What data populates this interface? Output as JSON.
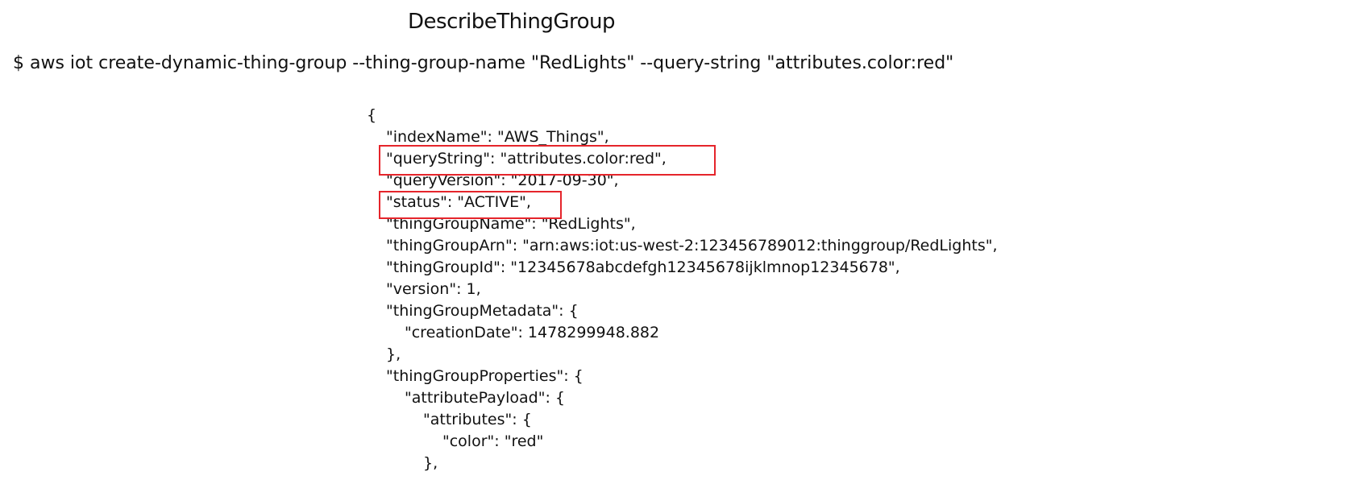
{
  "header": {
    "title": "DescribeThingGroup"
  },
  "command": {
    "text": "$ aws iot create-dynamic-thing-group --thing-group-name \"RedLights\" --query-string \"attributes.color:red\""
  },
  "response": {
    "lines": [
      "{",
      "\"indexName\": \"AWS_Things\",",
      "\"queryString\": \"attributes.color:red\",",
      "\"queryVersion\": \"2017-09-30\",",
      "\"status\": \"ACTIVE\",",
      "\"thingGroupName\": \"RedLights\",",
      "\"thingGroupArn\": \"arn:aws:iot:us-west-2:123456789012:thinggroup/RedLights\",",
      "\"thingGroupId\": \"12345678abcdefgh12345678ijklmnop12345678\",",
      "\"version\": 1,",
      "\"thingGroupMetadata\": {",
      "\"creationDate\": 1478299948.882",
      "},",
      "\"thingGroupProperties\": {",
      "\"attributePayload\": {",
      "\"attributes\": {",
      "\"color\": \"red\"",
      "},"
    ]
  },
  "highlight_color": "#e5252b"
}
